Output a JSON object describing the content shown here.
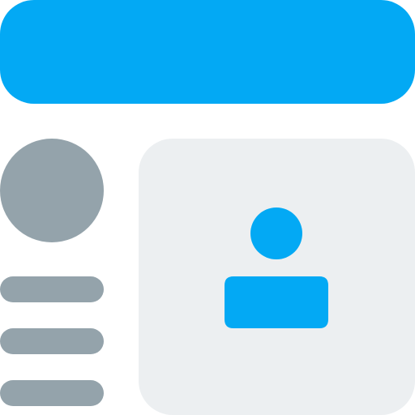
{
  "icon": {
    "name": "profile-card-layout-icon",
    "colors": {
      "accent": "#03A9F4",
      "muted": "#94A3AB",
      "panel": "#ECEFF1",
      "background": "#FFFFFF"
    },
    "elements": {
      "header": "header-bar",
      "avatar": "avatar-circle",
      "lines": [
        "text-line-1",
        "text-line-2",
        "text-line-3"
      ],
      "panel": "profile-panel",
      "user": "user-icon"
    }
  }
}
